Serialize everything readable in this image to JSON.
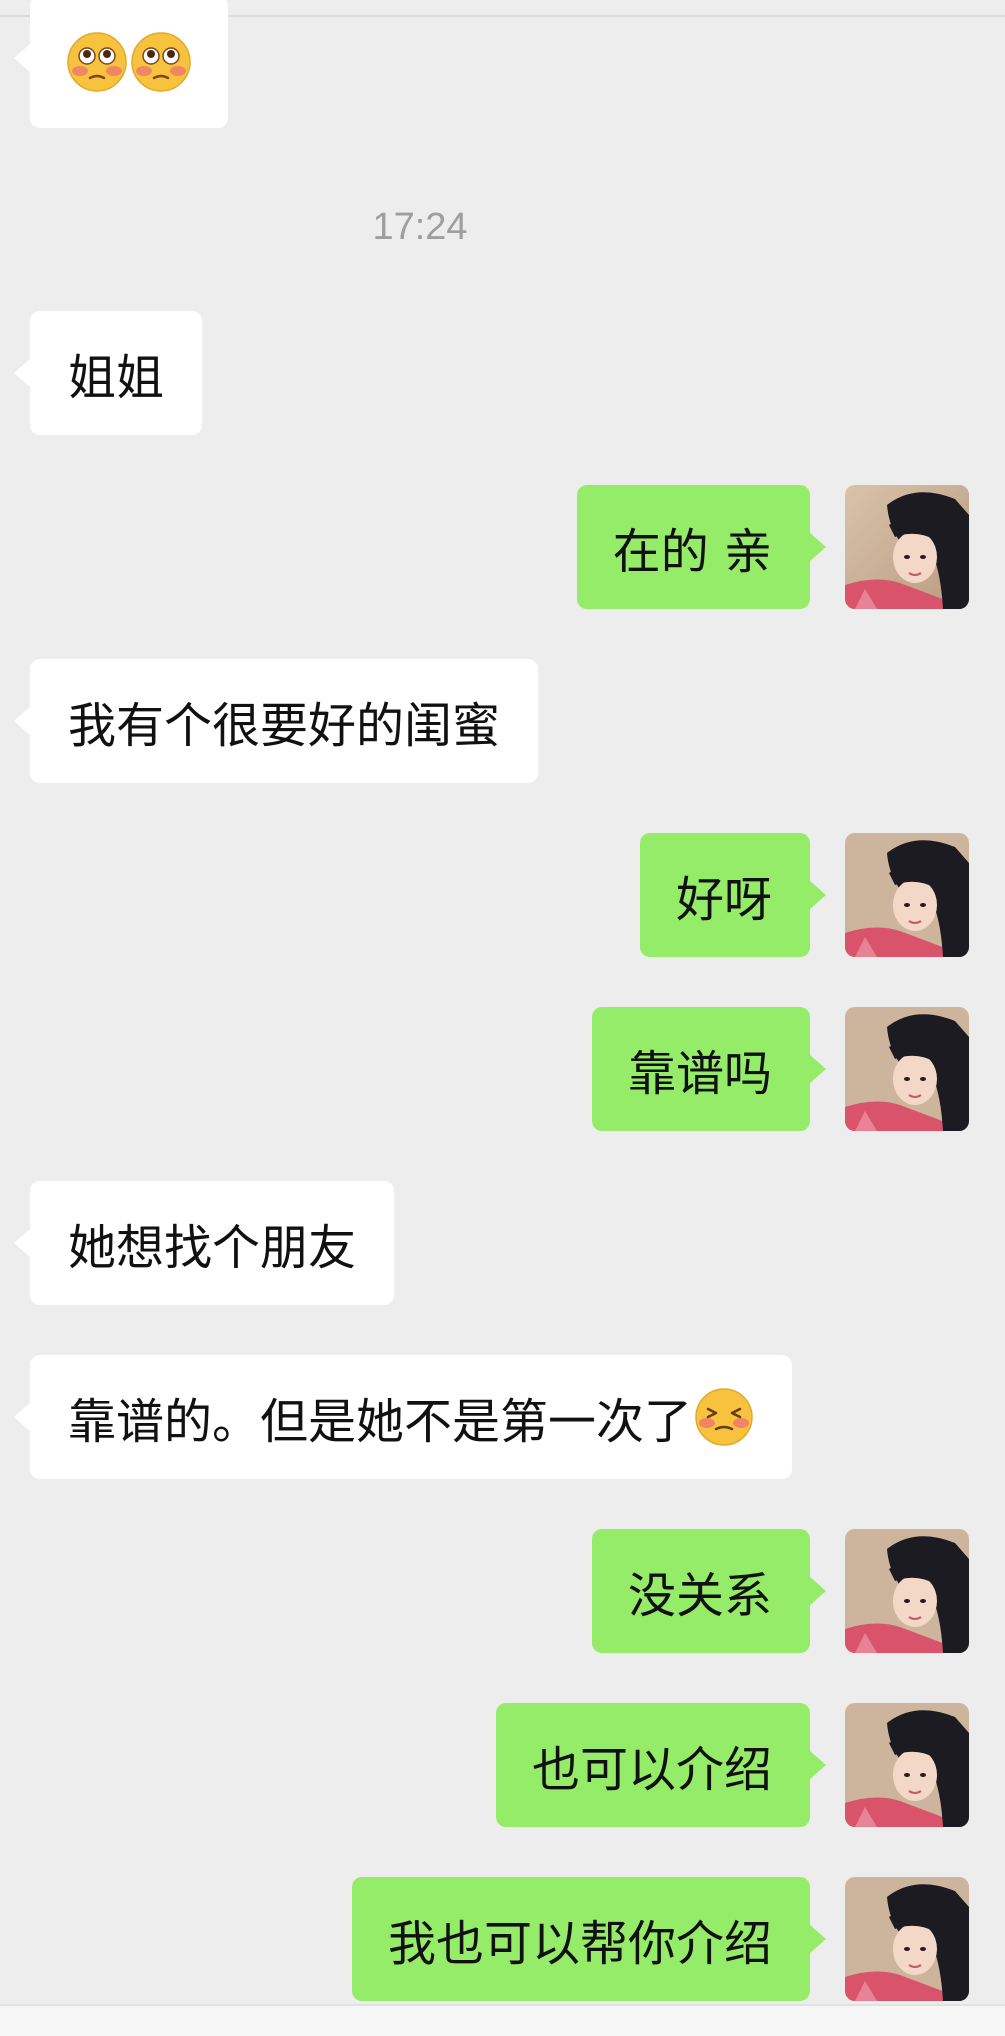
{
  "chat": {
    "timestamp": "17:24",
    "messages": [
      {
        "side": "in",
        "text": "",
        "emoji": [
          "flushed-face",
          "flushed-face"
        ]
      },
      {
        "side": "in",
        "text": "姐姐"
      },
      {
        "side": "out",
        "text": "在的 亲"
      },
      {
        "side": "in",
        "text": "我有个很要好的闺蜜"
      },
      {
        "side": "out",
        "text": "好呀"
      },
      {
        "side": "out",
        "text": "靠谱吗"
      },
      {
        "side": "in",
        "text": "她想找个朋友"
      },
      {
        "side": "in",
        "text": "靠谱的。但是她不是第一次了",
        "emoji": [
          "grimacing-blush-face"
        ]
      },
      {
        "side": "out",
        "text": "没关系"
      },
      {
        "side": "out",
        "text": "也可以介绍"
      },
      {
        "side": "out",
        "text": "我也可以帮你介绍"
      }
    ]
  },
  "colors": {
    "background": "#ededed",
    "incoming_bubble": "#ffffff",
    "outgoing_bubble": "#95ec69",
    "timestamp_text": "#9e9e9e"
  },
  "icons": {
    "avatar": "user-avatar-photo",
    "emoji_flushed": "flushed-face-emoji",
    "emoji_grimace": "grimacing-blush-face-emoji"
  }
}
